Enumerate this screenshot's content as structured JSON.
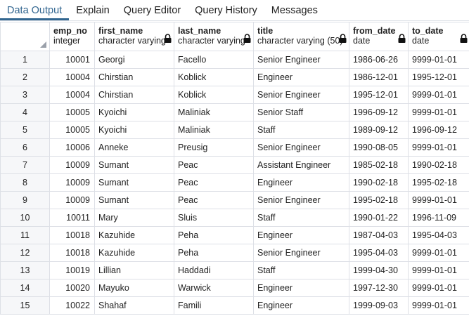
{
  "tabs": [
    {
      "label": "Data Output",
      "active": true
    },
    {
      "label": "Explain",
      "active": false
    },
    {
      "label": "Query Editor",
      "active": false
    },
    {
      "label": "Query History",
      "active": false
    },
    {
      "label": "Messages",
      "active": false
    }
  ],
  "columns": [
    {
      "name": "emp_no",
      "type": "integer"
    },
    {
      "name": "first_name",
      "type": "character varying"
    },
    {
      "name": "last_name",
      "type": "character varying"
    },
    {
      "name": "title",
      "type": "character varying (50)"
    },
    {
      "name": "from_date",
      "type": "date"
    },
    {
      "name": "to_date",
      "type": "date"
    }
  ],
  "rows": [
    [
      "1",
      "10001",
      "Georgi",
      "Facello",
      "Senior Engineer",
      "1986-06-26",
      "9999-01-01"
    ],
    [
      "2",
      "10004",
      "Chirstian",
      "Koblick",
      "Engineer",
      "1986-12-01",
      "1995-12-01"
    ],
    [
      "3",
      "10004",
      "Chirstian",
      "Koblick",
      "Senior Engineer",
      "1995-12-01",
      "9999-01-01"
    ],
    [
      "4",
      "10005",
      "Kyoichi",
      "Maliniak",
      "Senior Staff",
      "1996-09-12",
      "9999-01-01"
    ],
    [
      "5",
      "10005",
      "Kyoichi",
      "Maliniak",
      "Staff",
      "1989-09-12",
      "1996-09-12"
    ],
    [
      "6",
      "10006",
      "Anneke",
      "Preusig",
      "Senior Engineer",
      "1990-08-05",
      "9999-01-01"
    ],
    [
      "7",
      "10009",
      "Sumant",
      "Peac",
      "Assistant Engineer",
      "1985-02-18",
      "1990-02-18"
    ],
    [
      "8",
      "10009",
      "Sumant",
      "Peac",
      "Engineer",
      "1990-02-18",
      "1995-02-18"
    ],
    [
      "9",
      "10009",
      "Sumant",
      "Peac",
      "Senior Engineer",
      "1995-02-18",
      "9999-01-01"
    ],
    [
      "10",
      "10011",
      "Mary",
      "Sluis",
      "Staff",
      "1990-01-22",
      "1996-11-09"
    ],
    [
      "11",
      "10018",
      "Kazuhide",
      "Peha",
      "Engineer",
      "1987-04-03",
      "1995-04-03"
    ],
    [
      "12",
      "10018",
      "Kazuhide",
      "Peha",
      "Senior Engineer",
      "1995-04-03",
      "9999-01-01"
    ],
    [
      "13",
      "10019",
      "Lillian",
      "Haddadi",
      "Staff",
      "1999-04-30",
      "9999-01-01"
    ],
    [
      "14",
      "10020",
      "Mayuko",
      "Warwick",
      "Engineer",
      "1997-12-30",
      "9999-01-01"
    ],
    [
      "15",
      "10022",
      "Shahaf",
      "Famili",
      "Engineer",
      "1999-09-03",
      "9999-01-01"
    ]
  ]
}
